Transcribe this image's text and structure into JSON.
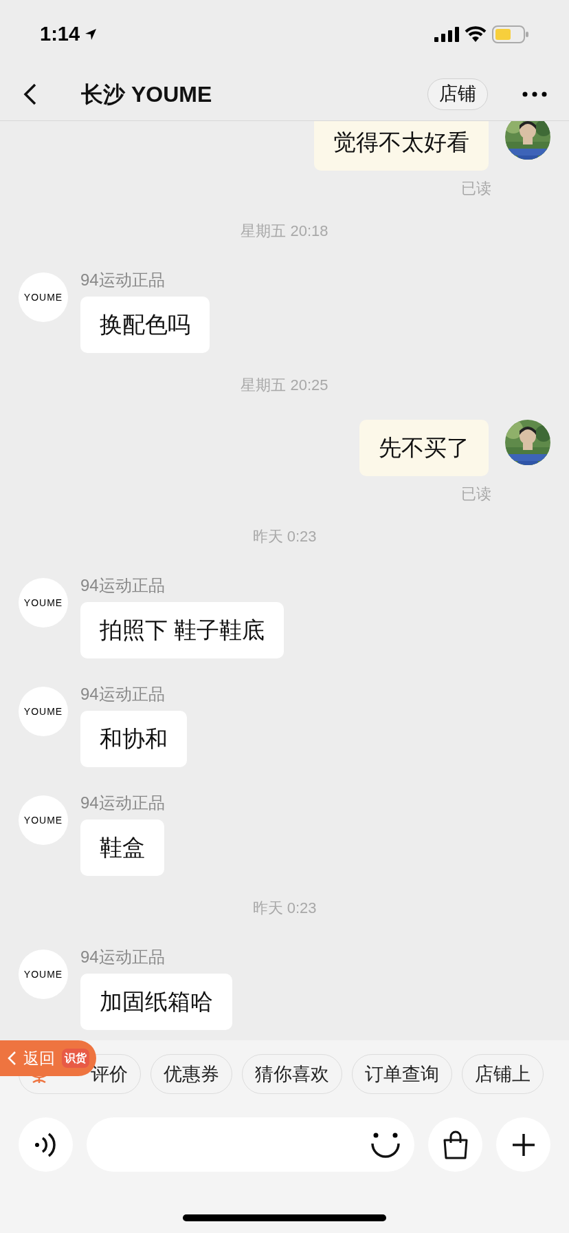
{
  "status_bar": {
    "time": "1:14"
  },
  "nav": {
    "title": "长沙 YOUME",
    "shop_button": "店铺"
  },
  "messages": [
    {
      "kind": "outgoing",
      "text": "觉得不太好看",
      "receipt": "已读"
    },
    {
      "kind": "time",
      "text": "星期五 20:18"
    },
    {
      "kind": "incoming",
      "avatar_text": "YOUME",
      "sender": "94运动正品",
      "text": "换配色吗"
    },
    {
      "kind": "time",
      "text": "星期五 20:25"
    },
    {
      "kind": "outgoing",
      "text": "先不买了",
      "receipt": "已读"
    },
    {
      "kind": "time",
      "text": "昨天 0:23"
    },
    {
      "kind": "incoming",
      "avatar_text": "YOUME",
      "sender": "94运动正品",
      "text": "拍照下 鞋子鞋底"
    },
    {
      "kind": "incoming",
      "avatar_text": "YOUME",
      "sender": "94运动正品",
      "text": "和协和"
    },
    {
      "kind": "incoming",
      "avatar_text": "YOUME",
      "sender": "94运动正品",
      "text": "鞋盒"
    },
    {
      "kind": "time",
      "text": "昨天 0:23"
    },
    {
      "kind": "incoming",
      "avatar_text": "YOUME",
      "sender": "94运动正品",
      "text": "加固纸箱哈"
    }
  ],
  "quick_chips": [
    {
      "kind": "icon",
      "label": "评价"
    },
    {
      "kind": "plain",
      "label": "优惠券"
    },
    {
      "kind": "plain",
      "label": "猜你喜欢"
    },
    {
      "kind": "plain",
      "label": "订单查询"
    },
    {
      "kind": "plain",
      "label": "店铺上"
    }
  ],
  "back_badge": {
    "label": "返回",
    "app": "识货"
  }
}
